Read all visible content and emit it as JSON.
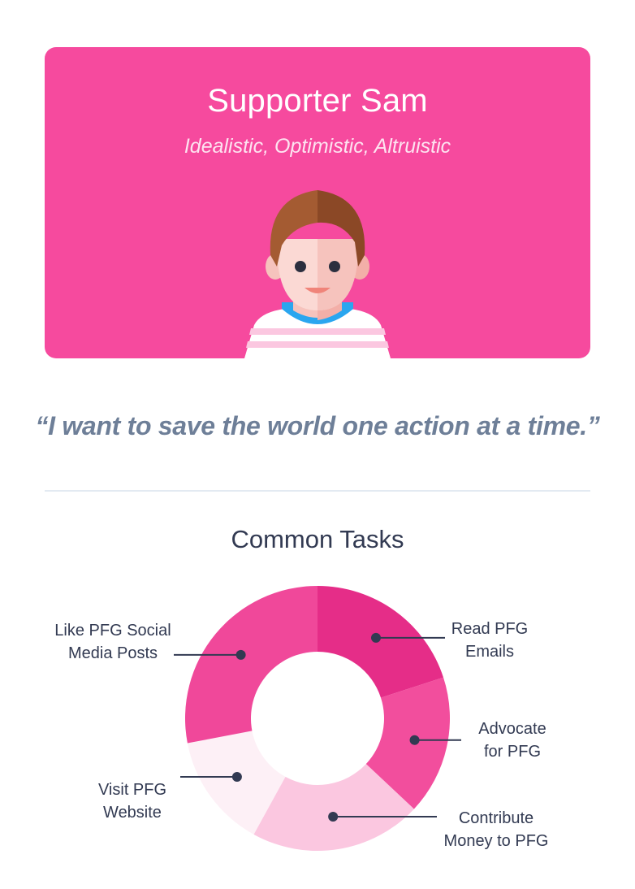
{
  "persona": {
    "name": "Supporter Sam",
    "traits": "Idealistic, Optimistic, Altruistic",
    "quote": "“I want to save the world one action at a time.”"
  },
  "section": {
    "title": "Common Tasks"
  },
  "colors": {
    "hero_bg": "#f64a9e",
    "quote": "#6e7f98",
    "text_dark": "#323a52"
  },
  "chart_data": {
    "type": "pie",
    "title": "Common Tasks",
    "slices": [
      {
        "label_line1": "Read PFG",
        "label_line2": "Emails",
        "value": 20,
        "color": "#e52d88"
      },
      {
        "label_line1": "Advocate",
        "label_line2": "for PFG",
        "value": 17,
        "color": "#f24e9d"
      },
      {
        "label_line1": "Contribute",
        "label_line2": "Money to PFG",
        "value": 21,
        "color": "#fbc7e0"
      },
      {
        "label_line1": "Visit PFG",
        "label_line2": "Website",
        "value": 14,
        "color": "#fdf0f6"
      },
      {
        "label_line1": "Like PFG Social",
        "label_line2": "Media Posts",
        "value": 28,
        "color": "#f0489a"
      }
    ]
  }
}
